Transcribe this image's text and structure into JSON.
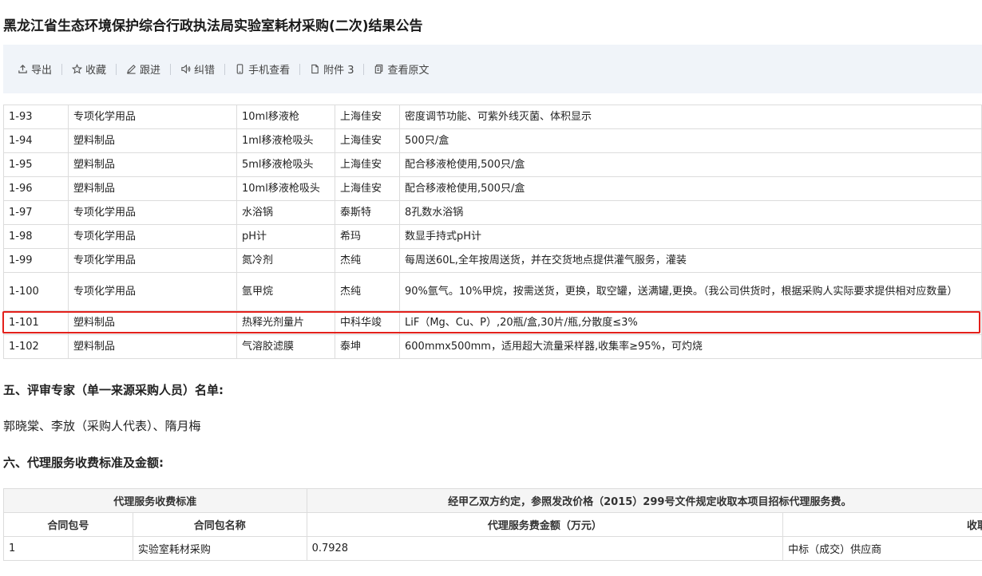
{
  "page": {
    "title": "黑龙江省生态环境保护综合行政执法局实验室耗材采购(二次)结果公告"
  },
  "toolbar": [
    {
      "icon": "export-icon",
      "label": "导出"
    },
    {
      "icon": "star-icon",
      "label": "收藏"
    },
    {
      "icon": "pen-icon",
      "label": "跟进"
    },
    {
      "icon": "speaker-icon",
      "label": "纠错"
    },
    {
      "icon": "phone-icon",
      "label": "手机查看"
    },
    {
      "icon": "attachment-icon",
      "label": "附件 3"
    },
    {
      "icon": "document-icon",
      "label": "查看原文"
    }
  ],
  "items": [
    {
      "no": "1-93",
      "category": "专项化学用品",
      "name": "10ml移液枪",
      "brand": "上海佳安",
      "spec": "密度调节功能、可紫外线灭菌、体积显示"
    },
    {
      "no": "1-94",
      "category": "塑料制品",
      "name": "1ml移液枪吸头",
      "brand": "上海佳安",
      "spec": "500只/盒"
    },
    {
      "no": "1-95",
      "category": "塑料制品",
      "name": "5ml移液枪吸头",
      "brand": "上海佳安",
      "spec": "配合移液枪使用,500只/盒"
    },
    {
      "no": "1-96",
      "category": "塑料制品",
      "name": "10ml移液枪吸头",
      "brand": "上海佳安",
      "spec": "配合移液枪使用,500只/盒"
    },
    {
      "no": "1-97",
      "category": "专项化学用品",
      "name": "水浴锅",
      "brand": "泰斯特",
      "spec": "8孔数水浴锅"
    },
    {
      "no": "1-98",
      "category": "专项化学用品",
      "name": "pH计",
      "brand": "希玛",
      "spec": "数显手持式pH计"
    },
    {
      "no": "1-99",
      "category": "专项化学用品",
      "name": "氮冷剂",
      "brand": "杰纯",
      "spec": "每周送60L,全年按周送货，并在交货地点提供灌气服务，灌装"
    },
    {
      "no": "1-100",
      "category": "专项化学用品",
      "name": "氩甲烷",
      "brand": "杰纯",
      "spec": "90%氩气。10%甲烷，按需送货，更换，取空罐，送满罐,更换。（我公司供货时，根据采购人实际要求提供相对应数量）"
    },
    {
      "no": "1-101",
      "category": "塑料制品",
      "name": "热释光剂量片",
      "brand": "中科华竣",
      "spec": "LiF（Mg、Cu、P）,20瓶/盒,30片/瓶,分散度≤3%"
    },
    {
      "no": "1-102",
      "category": "塑料制品",
      "name": "气溶胶滤膜",
      "brand": "泰坤",
      "spec": "600mmx500mm，适用超大流量采样器,收集率≥95%，可灼烧"
    }
  ],
  "section5": {
    "heading": "五、评审专家（单一来源采购人员）名单:",
    "text": "郭晓棠、李放（采购人代表）、隋月梅"
  },
  "section6": {
    "heading": "六、代理服务收费标准及金额:"
  },
  "fee_table": {
    "standard_label": "代理服务收费标准",
    "standard_text": "经甲乙双方约定，参照发改价格（2015）299号文件规定收取本项目招标代理服务费。",
    "headers": [
      "合同包号",
      "合同包名称",
      "代理服务费金额（万元）",
      "收取"
    ],
    "rows": [
      {
        "pkg": "1",
        "name": "实验室耗材采购",
        "amount": "0.7928",
        "payer": "中标（成交）供应商"
      }
    ]
  }
}
